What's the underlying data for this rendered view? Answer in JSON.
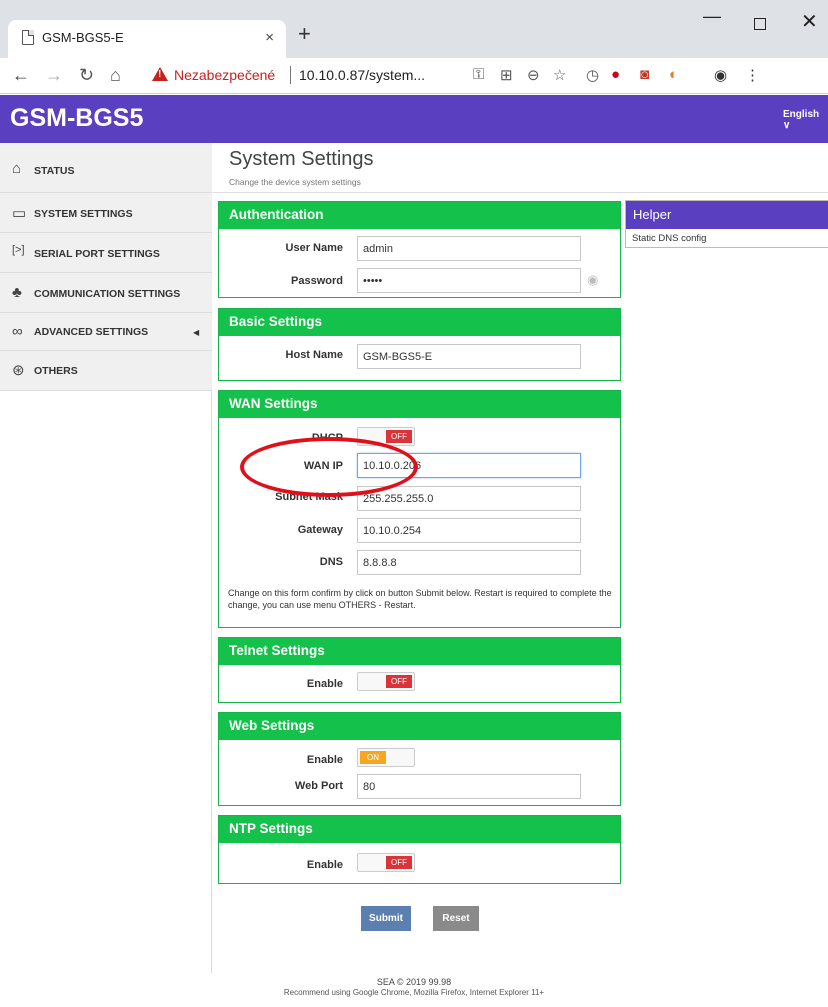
{
  "browser": {
    "tab_title": "GSM-BGS5-E",
    "tab_close": "×",
    "new_tab": "+",
    "minimize": "—",
    "close": "✕",
    "security_status": "Nezabezpečené",
    "url": "10.10.0.87/system..."
  },
  "app": {
    "title": "GSM-BGS5",
    "language": "English ∨"
  },
  "sidebar": {
    "items": [
      {
        "label": "STATUS",
        "icon": "home-icon"
      },
      {
        "label": "SYSTEM SETTINGS",
        "icon": "monitor-icon"
      },
      {
        "label": "SERIAL PORT SETTINGS",
        "icon": "terminal-icon"
      },
      {
        "label": "COMMUNICATION SETTINGS",
        "icon": "network-icon"
      },
      {
        "label": "ADVANCED SETTINGS",
        "icon": "infinity-icon"
      },
      {
        "label": "OTHERS",
        "icon": "dribbble-icon"
      }
    ]
  },
  "page": {
    "title": "System Settings",
    "subtitle": "Change the device system settings"
  },
  "auth": {
    "header": "Authentication",
    "username_label": "User Name",
    "username_value": "admin",
    "password_label": "Password",
    "password_value": "•••••"
  },
  "basic": {
    "header": "Basic Settings",
    "hostname_label": "Host Name",
    "hostname_value": "GSM-BGS5-E"
  },
  "wan": {
    "header": "WAN Settings",
    "dhcp_label": "DHCP",
    "dhcp_state": "OFF",
    "ip_label": "WAN IP",
    "ip_value": "10.10.0.206",
    "mask_label": "Subnet Mask",
    "mask_value": "255.255.255.0",
    "gateway_label": "Gateway",
    "gateway_value": "10.10.0.254",
    "dns_label": "DNS",
    "dns_value": "8.8.8.8",
    "note": "Change on this form confirm by click on button Submit below. Restart is required to complete the change, you can use menu OTHERS - Restart."
  },
  "telnet": {
    "header": "Telnet Settings",
    "enable_label": "Enable",
    "state": "OFF"
  },
  "web": {
    "header": "Web Settings",
    "enable_label": "Enable",
    "state": "ON",
    "port_label": "Web Port",
    "port_value": "80"
  },
  "ntp": {
    "header": "NTP Settings",
    "enable_label": "Enable",
    "state": "OFF"
  },
  "helper": {
    "header": "Helper",
    "text": "Static DNS config"
  },
  "actions": {
    "submit": "Submit",
    "reset": "Reset"
  },
  "footer": {
    "line1": "SEA © 2019 99.98",
    "line2": "Recommend using Google Chrome, Mozilla Firefox, Internet Explorer 11+"
  },
  "colors": {
    "header_purple": "#5a3fc0",
    "panel_green": "#14c14a",
    "toggle_off_red": "#d9343a",
    "toggle_on_orange": "#f5a623",
    "annotation_red": "#e0101a"
  }
}
